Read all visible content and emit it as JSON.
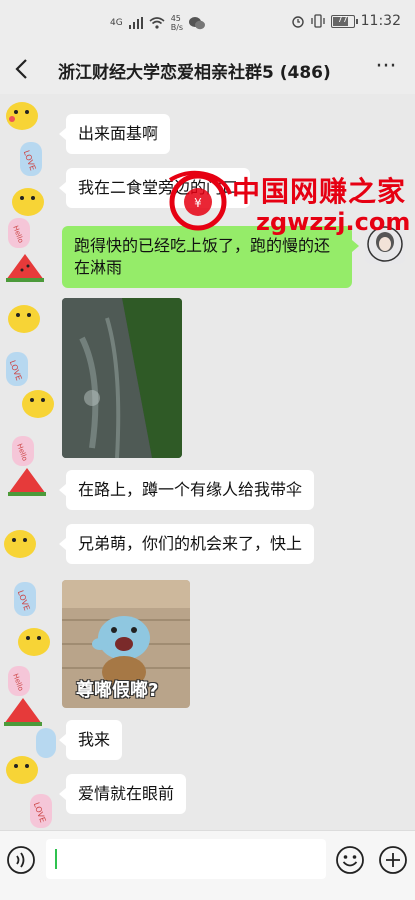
{
  "status_bar": {
    "network": "4G",
    "speed_value": "45",
    "speed_unit": "B/s",
    "battery_level": "77",
    "battery_fraction": 0.77,
    "time": "11:32"
  },
  "header": {
    "title": "浙江财经大学恋爱相亲社群5 (486)",
    "back_icon": "chevron-left-icon",
    "more_label": "···"
  },
  "messages": [
    {
      "type": "text",
      "side": "left",
      "text": "出来面基啊"
    },
    {
      "type": "text",
      "side": "left",
      "text": "我在二食堂旁边的门口"
    },
    {
      "type": "text",
      "side": "right",
      "text": "跑得快的已经吃上饭了，跑的慢的还在淋雨"
    },
    {
      "type": "image",
      "side": "left",
      "alt": "rainy-road-photo"
    },
    {
      "type": "text",
      "side": "left",
      "text": "在路上，蹲一个有缘人给我带伞"
    },
    {
      "type": "text",
      "side": "left",
      "text": "兄弟萌，你们的机会来了，快上"
    },
    {
      "type": "sticker",
      "side": "left",
      "caption": "尊嘟假嘟?"
    },
    {
      "type": "text",
      "side": "left",
      "text": "我来"
    },
    {
      "type": "text",
      "side": "left",
      "text": "爱情就在眼前"
    }
  ],
  "watermark": {
    "title": "中国网赚之家",
    "url": "zgwzzj.com"
  },
  "input_bar": {
    "voice_icon": "voice-icon",
    "emoji_icon": "emoji-icon",
    "plus_icon": "plus-icon",
    "text_value": ""
  },
  "colors": {
    "self_bubble": "#95ec69",
    "other_bubble": "#ffffff",
    "watermark_red": "#e60012",
    "watermark_url": "#e60012"
  }
}
